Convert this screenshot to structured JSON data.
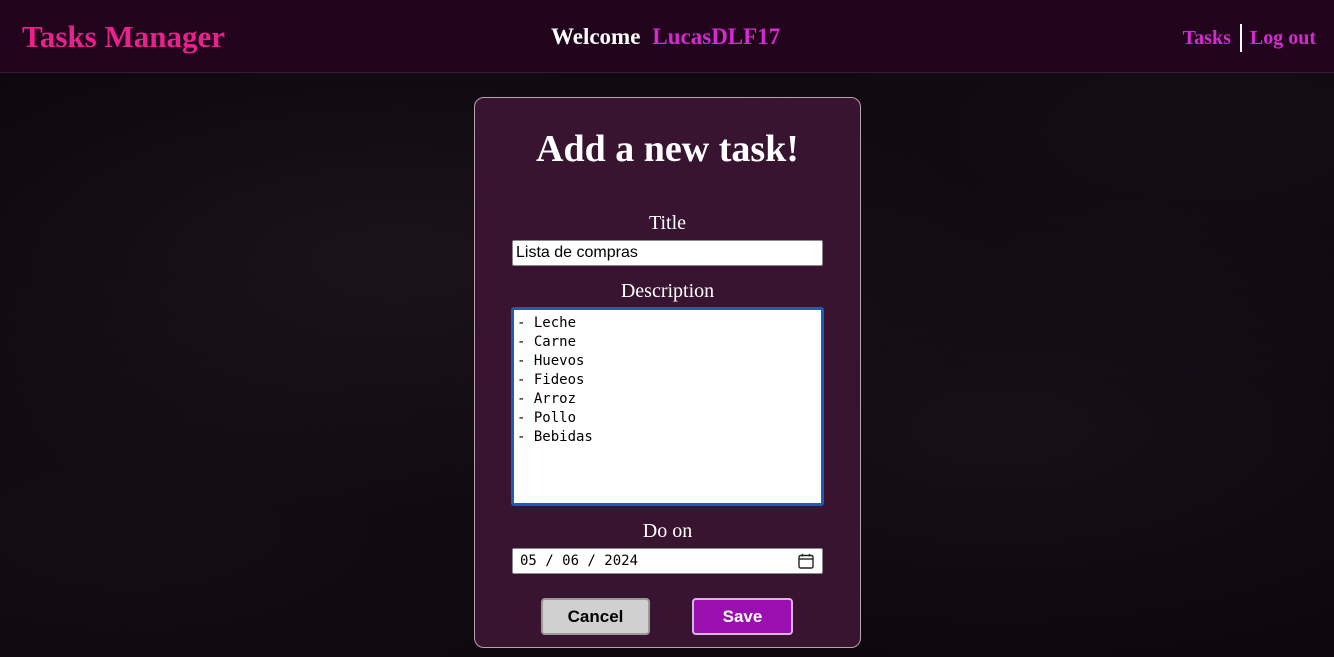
{
  "header": {
    "brand": "Tasks Manager",
    "welcome_label": "Welcome",
    "username": "LucasDLF17",
    "nav": {
      "tasks_label": "Tasks",
      "logout_label": "Log out"
    }
  },
  "form": {
    "heading": "Add a new task!",
    "title_label": "Title",
    "title_value": "Lista de compras",
    "description_label": "Description",
    "description_value": "- Leche\n- Carne\n- Huevos\n- Fideos\n- Arroz\n- Pollo\n- Bebidas",
    "do_on_label": "Do on",
    "do_on_value": "05 / 06 / 2024",
    "cancel_label": "Cancel",
    "save_label": "Save"
  },
  "colors": {
    "brand": "#e8218c",
    "username": "#d42ad0",
    "nav_link": "#d42ad0",
    "header_bg": "#22051d",
    "card_bg": "#391431",
    "save_button": "#9b0fb0",
    "cancel_button": "#d0d0d0",
    "focus_border": "#1a5fb4"
  },
  "icons": {
    "date_picker": "calendar-icon"
  }
}
